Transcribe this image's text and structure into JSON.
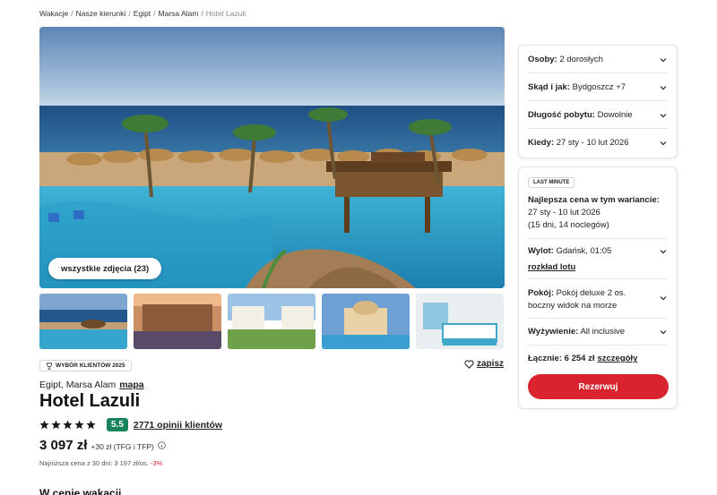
{
  "breadcrumb": {
    "items": [
      "Wakacje",
      "Nasze kierunki",
      "Egipt",
      "Marsa Alam"
    ],
    "current": "Hotel Lazuli",
    "separator": "/"
  },
  "gallery": {
    "all_photos_label": "wszystkie zdjęcia (23)",
    "thumbnail_count": 5
  },
  "hotel": {
    "badge_label": "WYBÓR KLIENTÓW 2025",
    "save_label": "zapisz",
    "location": "Egipt, Marsa Alam",
    "map_label": "mapa",
    "name": "Hotel Lazuli",
    "stars": 5,
    "score": "5.5",
    "reviews_label": "2771 opinii klientów",
    "price": "3 097 zł",
    "price_extra": "+30 zł (TFG i TFP)",
    "lowest_price_text": "Najniższa cena z 30 dni: 3 197 zł/os.",
    "discount": "-3%",
    "next_section_title": "W cenie wakacji"
  },
  "search": {
    "people": {
      "label": "Osoby:",
      "value": "2 dorosłych"
    },
    "from": {
      "label": "Skąd i jak:",
      "value": "Bydgoszcz +7"
    },
    "duration": {
      "label": "Długość pobytu:",
      "value": "Dowolnie"
    },
    "when": {
      "label": "Kiedy:",
      "value": "27 sty - 10 lut 2026"
    }
  },
  "offer": {
    "tag": "LAST MINUTE",
    "best_title": "Najlepsza cena w tym wariancie:",
    "best_dates": "27 sty - 10 lut 2026",
    "best_length": "(15 dni, 14 noclegów)",
    "flight": {
      "label": "Wylot:",
      "value": "Gdańsk, 01:05",
      "link": "rozkład lotu"
    },
    "room": {
      "label": "Pokój:",
      "value": "Pokój deluxe 2 os. boczny widok na morze"
    },
    "board": {
      "label": "Wyżywienie:",
      "value": "All inclusive"
    },
    "total": {
      "label": "Łącznie:",
      "value": "6 254 zł",
      "details_label": "szczegóły"
    },
    "reserve_label": "Rezerwuj"
  },
  "colors": {
    "accent": "#d9232e",
    "score_bg": "#17845b",
    "discount": "#d6202c",
    "star": "#1a1a1a"
  },
  "icons": [
    "trophy-icon",
    "heart-icon",
    "star-icon",
    "info-icon",
    "chevron-down-icon"
  ]
}
